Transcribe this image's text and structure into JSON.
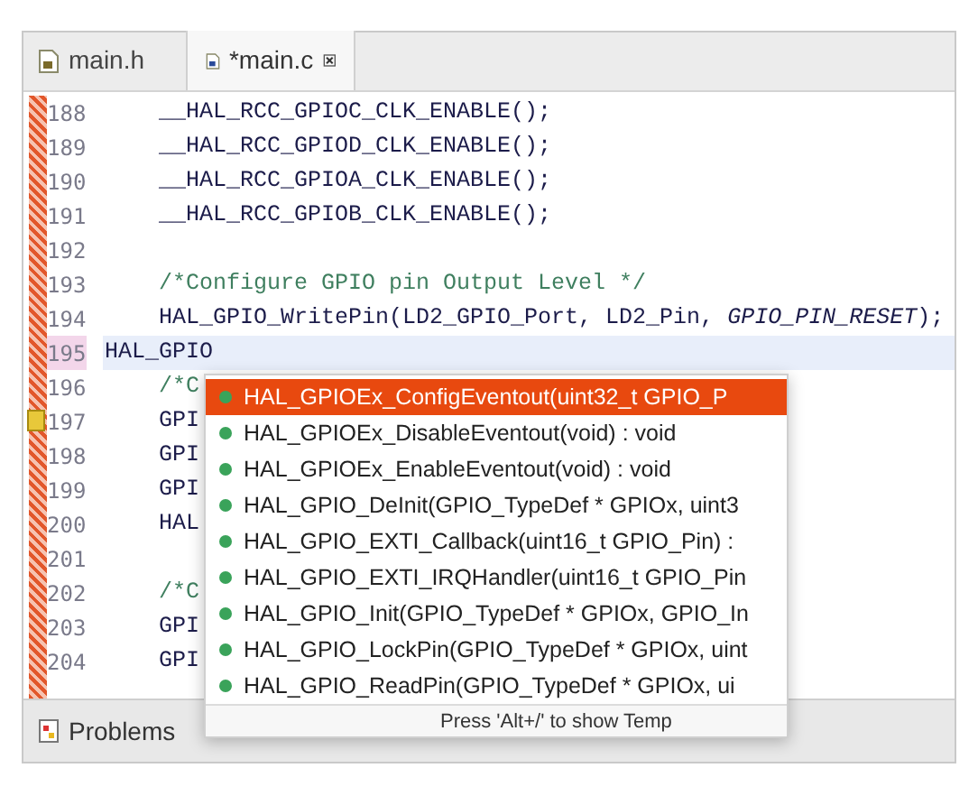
{
  "tabs": [
    {
      "label": "main.h",
      "kind": "header",
      "selected": false,
      "dirty": false
    },
    {
      "label": "*main.c",
      "kind": "source",
      "selected": true,
      "dirty": true
    }
  ],
  "lines": [
    {
      "number": "188",
      "text": "    __HAL_RCC_GPIOC_CLK_ENABLE();",
      "kind": "code",
      "current": false
    },
    {
      "number": "189",
      "text": "    __HAL_RCC_GPIOD_CLK_ENABLE();",
      "kind": "code",
      "current": false
    },
    {
      "number": "190",
      "text": "    __HAL_RCC_GPIOA_CLK_ENABLE();",
      "kind": "code",
      "current": false
    },
    {
      "number": "191",
      "text": "    __HAL_RCC_GPIOB_CLK_ENABLE();",
      "kind": "code",
      "current": false
    },
    {
      "number": "192",
      "current": false
    },
    {
      "number": "193",
      "text": "    /*Configure GPIO pin Output Level */",
      "kind": "comment",
      "current": false
    },
    {
      "number": "194",
      "text": "    HAL_GPIO_WritePin(LD2_GPIO_Port, LD2_Pin, *GPIO_PIN_RESET*);",
      "kind": "code",
      "current": false
    },
    {
      "number": "195",
      "text": "HAL_GPIO",
      "kind": "code",
      "current": true
    },
    {
      "number": "196",
      "text": "    /*C",
      "kind": "comment",
      "current": false
    },
    {
      "number": "197",
      "text": "    GPI",
      "kind": "code",
      "current": false,
      "warning": true
    },
    {
      "number": "198",
      "text": "    GPI",
      "kind": "code",
      "current": false
    },
    {
      "number": "199",
      "text": "    GPI",
      "kind": "code",
      "current": false
    },
    {
      "number": "200",
      "text": "    HAL",
      "kind": "code",
      "current": false
    },
    {
      "number": "201",
      "current": false
    },
    {
      "number": "202",
      "text": "    /*C",
      "kind": "comment",
      "current": false
    },
    {
      "number": "203",
      "text": "    GPI",
      "kind": "code",
      "current": false
    },
    {
      "number": "204",
      "text": "    GPI",
      "kind": "code",
      "current": false
    }
  ],
  "completion": {
    "items": [
      {
        "label": "HAL_GPIOEx_ConfigEventout(uint32_t GPIO_P",
        "selected": true
      },
      {
        "label": "HAL_GPIOEx_DisableEventout(void) : void",
        "selected": false
      },
      {
        "label": "HAL_GPIOEx_EnableEventout(void) : void",
        "selected": false
      },
      {
        "label": "HAL_GPIO_DeInit(GPIO_TypeDef * GPIOx, uint3",
        "selected": false
      },
      {
        "label": "HAL_GPIO_EXTI_Callback(uint16_t GPIO_Pin) :",
        "selected": false
      },
      {
        "label": "HAL_GPIO_EXTI_IRQHandler(uint16_t GPIO_Pin",
        "selected": false
      },
      {
        "label": "HAL_GPIO_Init(GPIO_TypeDef * GPIOx, GPIO_In",
        "selected": false
      },
      {
        "label": "HAL_GPIO_LockPin(GPIO_TypeDef * GPIOx, uint",
        "selected": false
      },
      {
        "label": "HAL_GPIO_ReadPin(GPIO_TypeDef * GPIOx, ui",
        "selected": false
      }
    ],
    "footer": "Press 'Alt+/' to show Temp"
  },
  "bottom_panel": {
    "tabs": [
      {
        "label": "Problems",
        "selected": false
      }
    ]
  }
}
